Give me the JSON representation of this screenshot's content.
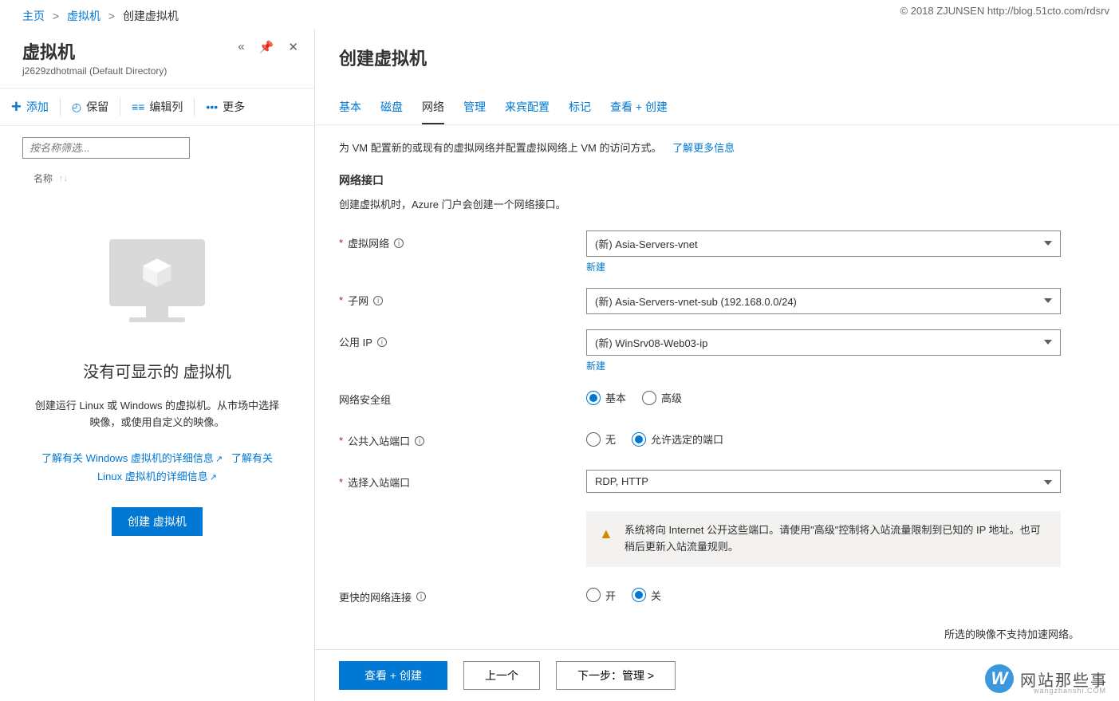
{
  "watermark": "© 2018 ZJUNSEN http://blog.51cto.com/rdsrv",
  "breadcrumb": {
    "home": "主页",
    "vm": "虚拟机",
    "create": "创建虚拟机",
    "sep": ">"
  },
  "left": {
    "title": "虚拟机",
    "subtitle": "j2629zdhotmail (Default Directory)",
    "toolbar": {
      "add": "添加",
      "keep": "保留",
      "editcols": "编辑列",
      "more": "更多"
    },
    "filter_placeholder": "按名称筛选...",
    "col_name": "名称",
    "empty_title": "没有可显示的 虚拟机",
    "empty_desc": "创建运行 Linux 或 Windows 的虚拟机。从市场中选择映像，或使用自定义的映像。",
    "learn_win": "了解有关 Windows 虚拟机的详细信息",
    "learn_lin": "了解有关 Linux 虚拟机的详细信息",
    "create_btn": "创建 虚拟机"
  },
  "right": {
    "title": "创建虚拟机",
    "tabs": {
      "basic": "基本",
      "disk": "磁盘",
      "network": "网络",
      "manage": "管理",
      "guest": "来宾配置",
      "tags": "标记",
      "review": "查看 + 创建"
    },
    "intro_text": "为 VM 配置新的或现有的虚拟网络并配置虚拟网络上 VM 的访问方式。",
    "intro_link": "了解更多信息",
    "section_title": "网络接口",
    "section_desc": "创建虚拟机时，Azure 门户会创建一个网络接口。",
    "labels": {
      "vnet": "虚拟网络",
      "subnet": "子网",
      "pip": "公用 IP",
      "nsg": "网络安全组",
      "pubports": "公共入站端口",
      "selports": "选择入站端口",
      "accel": "更快的网络连接"
    },
    "values": {
      "vnet": "(新) Asia-Servers-vnet",
      "subnet": "(新) Asia-Servers-vnet-sub (192.168.0.0/24)",
      "pip": "(新) WinSrv08-Web03-ip",
      "selports": "RDP, HTTP"
    },
    "newlink": "新建",
    "radios": {
      "nsg_basic": "基本",
      "nsg_adv": "高级",
      "ports_none": "无",
      "ports_allow": "允许选定的端口",
      "accel_on": "开",
      "accel_off": "关"
    },
    "warning": "系统将向 Internet 公开这些端口。请使用\"高级\"控制将入站流量限制到已知的 IP 地址。也可稍后更新入站流量规则。",
    "note": "所选的映像不支持加速网络。",
    "footer": {
      "review": "查看 + 创建",
      "prev": "上一个",
      "next": "下一步：管理 >"
    }
  },
  "brand": {
    "letter": "W",
    "text": "网站那些事",
    "url": "wangzhanshi.COM"
  }
}
